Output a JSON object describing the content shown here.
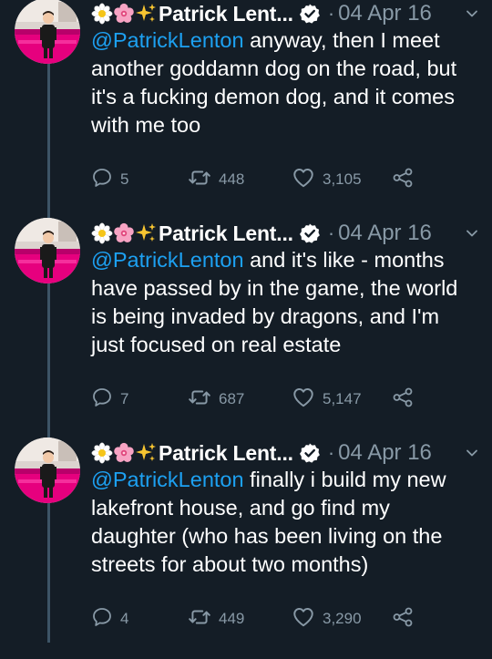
{
  "tweets": [
    {
      "name": "Patrick Lent...",
      "dot": "·",
      "date": "04 Apr 16",
      "mention": "@PatrickLenton",
      "body": " anyway, then I meet another goddamn dog on the road, but it's a fucking demon dog, and it comes with me too",
      "replies": "5",
      "retweets": "448",
      "likes": "3,105"
    },
    {
      "name": "Patrick Lent...",
      "dot": "·",
      "date": "04 Apr 16",
      "mention": "@PatrickLenton",
      "body": " and it's like - months have passed by in the game, the world is being invaded by dragons, and I'm just focused on real estate",
      "replies": "7",
      "retweets": "687",
      "likes": "5,147"
    },
    {
      "name": "Patrick Lent...",
      "dot": "·",
      "date": "04 Apr 16",
      "mention": "@PatrickLenton",
      "body": " finally i build my new lakefront house, and go find my daughter (who has been living on the streets for about two months)",
      "replies": "4",
      "retweets": "449",
      "likes": "3,290"
    }
  ],
  "theme": {
    "background": "#141d26",
    "text": "#ffffff",
    "muted": "#8899a6",
    "link": "#1da1f2",
    "thread_line": "#3d5466",
    "avatar_accent": "#e6007e"
  },
  "icons": {
    "header": [
      "daisy-flower-icon",
      "cherry-blossom-icon",
      "sparkles-icon",
      "verified-badge-icon",
      "chevron-down-icon"
    ],
    "actions": [
      "reply-icon",
      "retweet-icon",
      "like-heart-icon",
      "share-icon"
    ]
  }
}
